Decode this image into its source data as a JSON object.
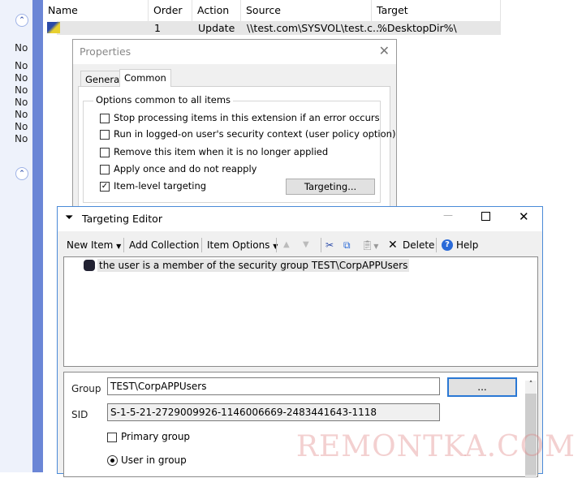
{
  "left_panel": {
    "values": [
      "No",
      "No",
      "No",
      "No",
      "No",
      "No",
      "No",
      "No"
    ]
  },
  "grid": {
    "columns": [
      "Name",
      "Order",
      "Action",
      "Source",
      "Target"
    ],
    "row": {
      "order": "1",
      "action": "Update",
      "source": "\\\\test.com\\SYSVOL\\test.c...",
      "target": "%DesktopDir%\\"
    }
  },
  "properties": {
    "title": "Properties",
    "tabs": [
      "General",
      "Common"
    ],
    "active_tab": "Common",
    "group_label": "Options common to all items",
    "options": [
      {
        "label": "Stop processing items in this extension if an error occurs",
        "checked": false
      },
      {
        "label": "Run in logged-on user's security context (user policy option)",
        "checked": false
      },
      {
        "label": "Remove this item when it is no longer applied",
        "checked": false
      },
      {
        "label": "Apply once and do not reapply",
        "checked": false
      },
      {
        "label": "Item-level targeting",
        "checked": true
      }
    ],
    "targeting_button": "Targeting..."
  },
  "targeting_editor": {
    "title": "Targeting Editor",
    "toolbar": {
      "new_item": "New Item",
      "add_collection": "Add Collection",
      "item_options": "Item Options",
      "delete": "Delete",
      "help": "Help"
    },
    "tree_item": "the user is a member of the security group TEST\\CorpAPPUsers",
    "group_label": "Group",
    "group_value": "TEST\\CorpAPPUsers",
    "browse_button": "...",
    "sid_label": "SID",
    "sid_value": "S-1-5-21-2729009926-1146006669-2483441643-1118",
    "primary_group": {
      "label": "Primary group",
      "checked": false
    },
    "user_in_group": {
      "label": "User in group",
      "selected": true
    }
  },
  "watermark": "REMONTKA.COM"
}
